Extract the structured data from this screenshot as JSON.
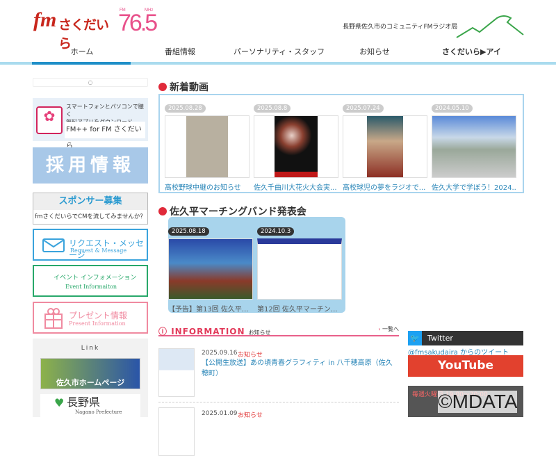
{
  "header": {
    "logo_fm": "fm",
    "logo_name": "さくだいら",
    "frequency": "76.5",
    "frequency_unit_left": "FM",
    "frequency_unit_right": "MHz",
    "tagline": "長野県佐久市のコミュニティFMラジオ局"
  },
  "nav": [
    {
      "label": "ホーム"
    },
    {
      "label": "番組情報"
    },
    {
      "label": "パーソナリティ・スタッフ"
    },
    {
      "label": "お知らせ"
    },
    {
      "label": "さくだいら▶アイ"
    }
  ],
  "sidebar": {
    "loader": "◌",
    "app": {
      "line1": "スマートフォンとパソコンで聴く",
      "line2": "無料アプリをダウンロード",
      "name": "FM++ for FM さくだいら"
    },
    "recruit": "採用情報",
    "sponsor": {
      "title": "スポンサー募集",
      "subtitle": "fmさくだいらでCMを流してみませんか？"
    },
    "request": {
      "ja": "リクエスト・メッセージ",
      "en": "Request & Message"
    },
    "event": {
      "ja": "イベント インフォメーション",
      "en": "Event Informaiton"
    },
    "present": {
      "ja": "プレゼント情報",
      "en": "Present Information"
    },
    "link": {
      "title": "Link",
      "banner1": "佐久市ホームページ",
      "banner2": "長野県",
      "banner2_en": "Nagano Prefecture"
    }
  },
  "new_videos": {
    "title": "新着動画",
    "items": [
      {
        "date": "2025.08.28",
        "title": "高校野球中継のお知らせ"
      },
      {
        "date": "2025.08.8",
        "title": "佐久千曲川大花火大会実..."
      },
      {
        "date": "2025.07.24",
        "title": "高校球児の夢をラジオで..."
      },
      {
        "date": "2024.05.10",
        "title": "佐久大学で学ぼう！2024..."
      }
    ]
  },
  "marching": {
    "title": "佐久平マーチングバンド発表会",
    "items": [
      {
        "date": "2025.08.18",
        "title": "【予告】第13回 佐久平..."
      },
      {
        "date": "2024.10.3",
        "title": "第12回 佐久平マーチン..."
      }
    ]
  },
  "information": {
    "title": "INFORMATION",
    "subtitle": "お知らせ",
    "more": "一覧へ",
    "items": [
      {
        "date": "2025.09.16",
        "category": "お知らせ",
        "title": "【公開生放送】あの頃青春グラフィティ in 八千穂高原（佐久穂町）"
      },
      {
        "date": "2025.01.09",
        "category": "お知らせ",
        "title": ""
      }
    ]
  },
  "right": {
    "twitter": "Twitter",
    "twitter_link": "@fmsakudaira からのツイート",
    "youtube": "YouTube",
    "program_banner": "毎週火曜日 19:00～20:00"
  },
  "watermark": "©MDATA"
}
